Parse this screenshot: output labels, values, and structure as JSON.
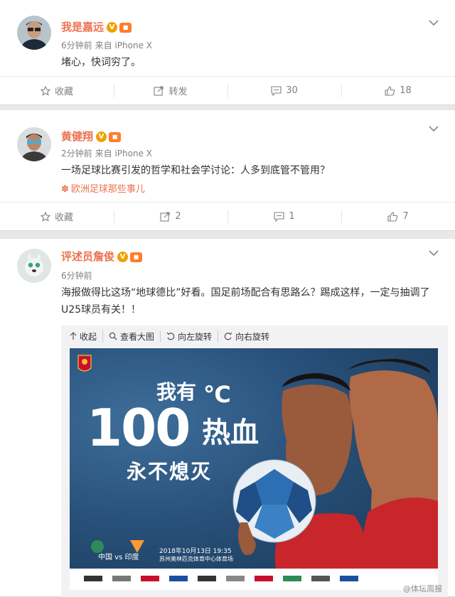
{
  "posts": [
    {
      "user": "我是嘉远",
      "time": "6分钟前",
      "source": "来自 iPhone X",
      "text": "堵心，快词穷了。",
      "actions": {
        "favorite": "收藏",
        "repost": "转发",
        "comment": "30",
        "like": "18"
      }
    },
    {
      "user": "黄健翔",
      "time": "2分钟前",
      "source": "来自 iPhone X",
      "text": "一场足球比赛引发的哲学和社会学讨论：人多到底管不管用？",
      "topic": "欧洲足球那些事儿",
      "actions": {
        "favorite": "收藏",
        "repost": "2",
        "comment": "1",
        "like": "7"
      }
    },
    {
      "user": "评述员詹俊",
      "time": "6分钟前",
      "text": "海报做得比这场“地球德比”好看。国足前场配合有思路么？踢成这样，一定与抽调了U25球员有关！！",
      "media_toolbar": {
        "collapse": "收起",
        "view_large": "查看大图",
        "rotate_left": "向左旋转",
        "rotate_right": "向右旋转"
      },
      "poster": {
        "line1": "我有",
        "unit": "℃",
        "number": "100",
        "line2": "热血",
        "line3": "永不熄灭",
        "match": "中国 vs 印度",
        "date": "2018年10月13日 19:35",
        "venue": "苏州奥林匹克体育中心体育场"
      },
      "watermark": "@体坛周报"
    }
  ],
  "colors": {
    "name": "#eb7350",
    "meta": "#808080",
    "badge_v": "#f1a000"
  }
}
